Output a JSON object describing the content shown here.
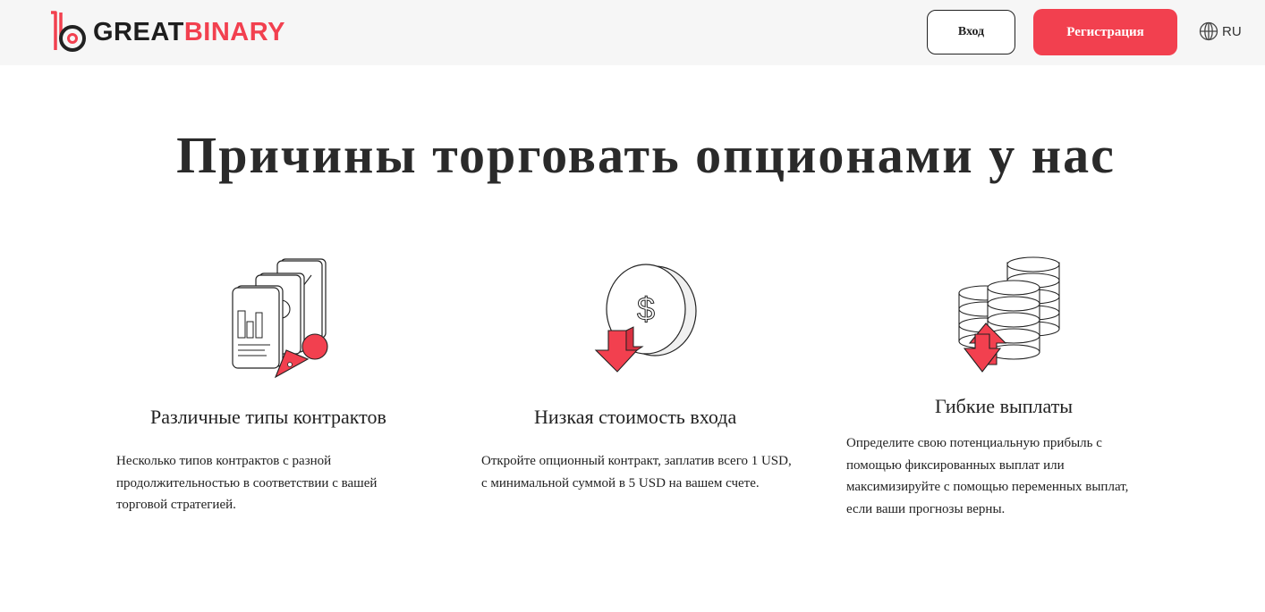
{
  "header": {
    "logo": {
      "text_primary": "GREAT",
      "text_accent": "BINARY",
      "icon": "logo-mark-icon"
    },
    "login_label": "Вход",
    "register_label": "Регистрация",
    "language": {
      "label": "RU",
      "icon": "globe-icon"
    }
  },
  "main": {
    "title": "Причины торговать опционами у нас",
    "features": [
      {
        "icon": "documents-chart-icon",
        "title": "Различные типы контрактов",
        "text": "Несколько типов контрактов с разной продолжительностью в соответствии с вашей торговой стратегией."
      },
      {
        "icon": "coin-arrow-down-icon",
        "title": "Низкая стоимость входа",
        "text": "Откройте опционный контракт, заплатив всего 1 USD, с минимальной суммой в 5 USD на вашем счете."
      },
      {
        "icon": "coins-stack-arrows-icon",
        "title": "Гибкие выплаты",
        "text": "Определите свою потенциальную прибыль с помощью фиксированных выплат или максимизируйте с помощью переменных выплат, если ваши прогнозы верны."
      }
    ]
  },
  "colors": {
    "accent": "#f2404f",
    "text": "#222222",
    "header_bg": "#f6f6f6"
  }
}
